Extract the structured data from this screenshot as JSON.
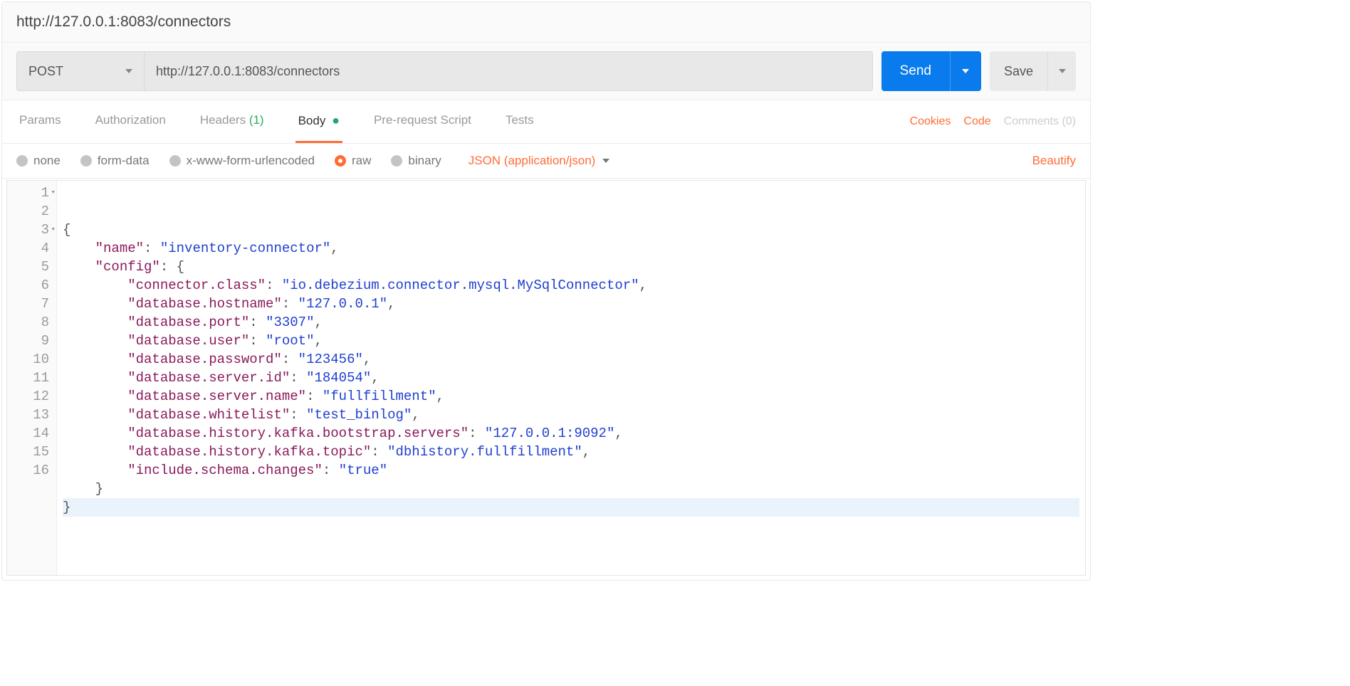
{
  "header": {
    "title_url": "http://127.0.0.1:8083/connectors"
  },
  "request": {
    "method": "POST",
    "url": "http://127.0.0.1:8083/connectors",
    "send_label": "Send",
    "save_label": "Save"
  },
  "tabs": {
    "params": "Params",
    "auth": "Authorization",
    "headers": "Headers",
    "headers_count": "(1)",
    "body": "Body",
    "prerequest": "Pre-request Script",
    "tests": "Tests"
  },
  "tab_links": {
    "cookies": "Cookies",
    "code": "Code",
    "comments": "Comments (0)"
  },
  "body_types": {
    "none": "none",
    "formdata": "form-data",
    "urlencoded": "x-www-form-urlencoded",
    "raw": "raw",
    "binary": "binary",
    "content_type": "JSON (application/json)",
    "beautify": "Beautify"
  },
  "editor": {
    "lines": [
      {
        "n": "1",
        "fold": true,
        "tokens": [
          {
            "t": "p",
            "v": "{"
          }
        ]
      },
      {
        "n": "2",
        "tokens": [
          {
            "t": "w",
            "v": "    "
          },
          {
            "t": "k",
            "v": "\"name\""
          },
          {
            "t": "p",
            "v": ": "
          },
          {
            "t": "s",
            "v": "\"inventory-connector\""
          },
          {
            "t": "p",
            "v": ","
          }
        ]
      },
      {
        "n": "3",
        "fold": true,
        "tokens": [
          {
            "t": "w",
            "v": "    "
          },
          {
            "t": "k",
            "v": "\"config\""
          },
          {
            "t": "p",
            "v": ": {"
          }
        ]
      },
      {
        "n": "4",
        "tokens": [
          {
            "t": "w",
            "v": "        "
          },
          {
            "t": "k",
            "v": "\"connector.class\""
          },
          {
            "t": "p",
            "v": ": "
          },
          {
            "t": "s",
            "v": "\"io.debezium.connector.mysql.MySqlConnector\""
          },
          {
            "t": "p",
            "v": ","
          }
        ]
      },
      {
        "n": "5",
        "tokens": [
          {
            "t": "w",
            "v": "        "
          },
          {
            "t": "k",
            "v": "\"database.hostname\""
          },
          {
            "t": "p",
            "v": ": "
          },
          {
            "t": "s",
            "v": "\"127.0.0.1\""
          },
          {
            "t": "p",
            "v": ","
          }
        ]
      },
      {
        "n": "6",
        "tokens": [
          {
            "t": "w",
            "v": "        "
          },
          {
            "t": "k",
            "v": "\"database.port\""
          },
          {
            "t": "p",
            "v": ": "
          },
          {
            "t": "s",
            "v": "\"3307\""
          },
          {
            "t": "p",
            "v": ","
          }
        ]
      },
      {
        "n": "7",
        "tokens": [
          {
            "t": "w",
            "v": "        "
          },
          {
            "t": "k",
            "v": "\"database.user\""
          },
          {
            "t": "p",
            "v": ": "
          },
          {
            "t": "s",
            "v": "\"root\""
          },
          {
            "t": "p",
            "v": ","
          }
        ]
      },
      {
        "n": "8",
        "tokens": [
          {
            "t": "w",
            "v": "        "
          },
          {
            "t": "k",
            "v": "\"database.password\""
          },
          {
            "t": "p",
            "v": ": "
          },
          {
            "t": "s",
            "v": "\"123456\""
          },
          {
            "t": "p",
            "v": ","
          }
        ]
      },
      {
        "n": "9",
        "tokens": [
          {
            "t": "w",
            "v": "        "
          },
          {
            "t": "k",
            "v": "\"database.server.id\""
          },
          {
            "t": "p",
            "v": ": "
          },
          {
            "t": "s",
            "v": "\"184054\""
          },
          {
            "t": "p",
            "v": ","
          }
        ]
      },
      {
        "n": "10",
        "tokens": [
          {
            "t": "w",
            "v": "        "
          },
          {
            "t": "k",
            "v": "\"database.server.name\""
          },
          {
            "t": "p",
            "v": ": "
          },
          {
            "t": "s",
            "v": "\"fullfillment\""
          },
          {
            "t": "p",
            "v": ","
          }
        ]
      },
      {
        "n": "11",
        "tokens": [
          {
            "t": "w",
            "v": "        "
          },
          {
            "t": "k",
            "v": "\"database.whitelist\""
          },
          {
            "t": "p",
            "v": ": "
          },
          {
            "t": "s",
            "v": "\"test_binlog\""
          },
          {
            "t": "p",
            "v": ","
          }
        ]
      },
      {
        "n": "12",
        "tokens": [
          {
            "t": "w",
            "v": "        "
          },
          {
            "t": "k",
            "v": "\"database.history.kafka.bootstrap.servers\""
          },
          {
            "t": "p",
            "v": ": "
          },
          {
            "t": "s",
            "v": "\"127.0.0.1:9092\""
          },
          {
            "t": "p",
            "v": ","
          }
        ]
      },
      {
        "n": "13",
        "tokens": [
          {
            "t": "w",
            "v": "        "
          },
          {
            "t": "k",
            "v": "\"database.history.kafka.topic\""
          },
          {
            "t": "p",
            "v": ": "
          },
          {
            "t": "s",
            "v": "\"dbhistory.fullfillment\""
          },
          {
            "t": "p",
            "v": ","
          }
        ]
      },
      {
        "n": "14",
        "tokens": [
          {
            "t": "w",
            "v": "        "
          },
          {
            "t": "k",
            "v": "\"include.schema.changes\""
          },
          {
            "t": "p",
            "v": ": "
          },
          {
            "t": "s",
            "v": "\"true\""
          }
        ]
      },
      {
        "n": "15",
        "tokens": [
          {
            "t": "w",
            "v": "    "
          },
          {
            "t": "p",
            "v": "}"
          }
        ]
      },
      {
        "n": "16",
        "hl": true,
        "tokens": [
          {
            "t": "p",
            "v": "}"
          }
        ]
      }
    ]
  },
  "request_body_json": {
    "name": "inventory-connector",
    "config": {
      "connector.class": "io.debezium.connector.mysql.MySqlConnector",
      "database.hostname": "127.0.0.1",
      "database.port": "3307",
      "database.user": "root",
      "database.password": "123456",
      "database.server.id": "184054",
      "database.server.name": "fullfillment",
      "database.whitelist": "test_binlog",
      "database.history.kafka.bootstrap.servers": "127.0.0.1:9092",
      "database.history.kafka.topic": "dbhistory.fullfillment",
      "include.schema.changes": "true"
    }
  }
}
